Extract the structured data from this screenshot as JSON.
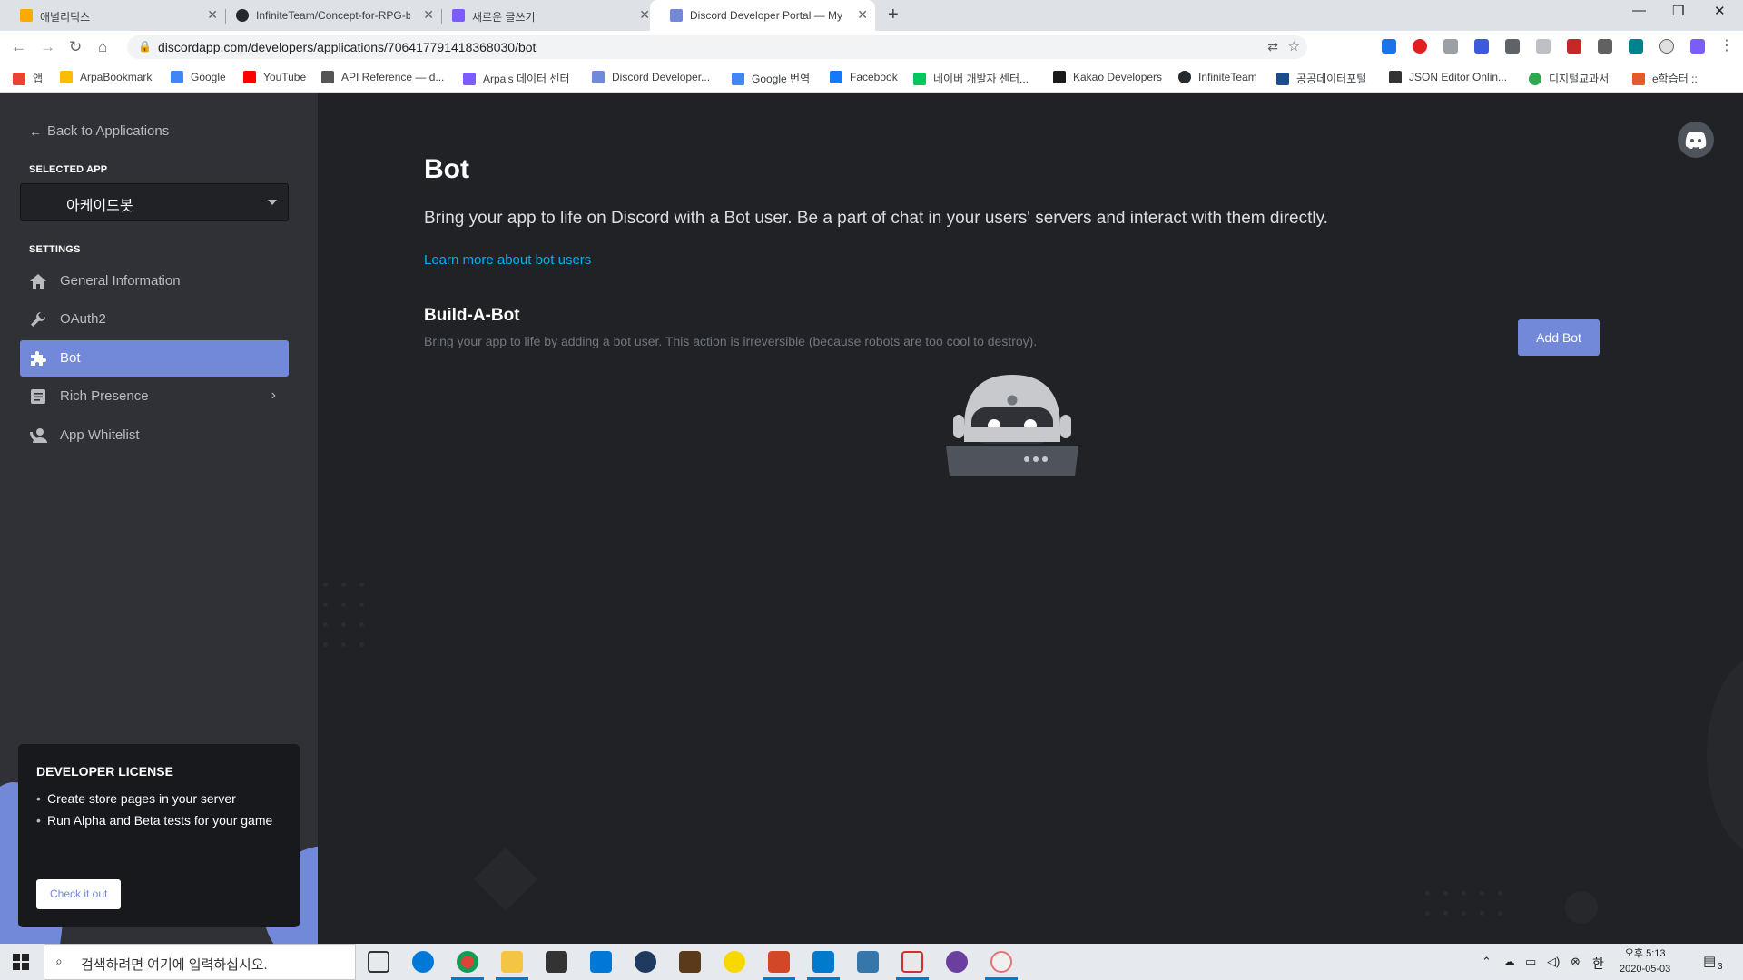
{
  "browser": {
    "tabs": [
      {
        "title": "애널리틱스",
        "color": "#f9ab00"
      },
      {
        "title": "InfiniteTeam/Concept-for-RPG-b",
        "color": "#24292e"
      },
      {
        "title": "새로운 글쓰기",
        "color": "#7c5cff"
      },
      {
        "title": "Discord Developer Portal — My",
        "color": "#7289da"
      }
    ],
    "url": "discordapp.com/developers/applications/706417791418368030/bot",
    "bookmarks": [
      {
        "label": "앱",
        "color": "#ea4335"
      },
      {
        "label": "ArpaBookmark",
        "color": "#fbbc04"
      },
      {
        "label": "Google",
        "color": "#4285f4"
      },
      {
        "label": "YouTube",
        "color": "#ff0000"
      },
      {
        "label": "API Reference — d...",
        "color": "#555555"
      },
      {
        "label": "Arpa's 데이터 센터",
        "color": "#7c5cff"
      },
      {
        "label": "Discord Developer...",
        "color": "#7289da"
      },
      {
        "label": "Google 번역",
        "color": "#4285f4"
      },
      {
        "label": "Facebook",
        "color": "#1877f2"
      },
      {
        "label": "네이버 개발자 센터...",
        "color": "#03c75a"
      },
      {
        "label": "Kakao Developers",
        "color": "#1a1a1a"
      },
      {
        "label": "InfiniteTeam",
        "color": "#24292e"
      },
      {
        "label": "공공데이터포털",
        "color": "#1c4c8c"
      },
      {
        "label": "JSON Editor Onlin...",
        "color": "#333333"
      },
      {
        "label": "디지털교과서",
        "color": "#2fa84f"
      },
      {
        "label": "e학습터 ::",
        "color": "#e45a2b"
      }
    ]
  },
  "sidebar": {
    "back_label": "Back to Applications",
    "selected_app_label": "SELECTED APP",
    "selected_app_name": "아케이드봇",
    "settings_label": "SETTINGS",
    "items": [
      {
        "label": "General Information",
        "icon": "home-icon"
      },
      {
        "label": "OAuth2",
        "icon": "wrench-icon"
      },
      {
        "label": "Bot",
        "icon": "puzzle-icon",
        "active": true
      },
      {
        "label": "Rich Presence",
        "icon": "document-icon",
        "has_chevron": true
      },
      {
        "label": "App Whitelist",
        "icon": "person-phone-icon"
      }
    ],
    "license": {
      "title": "DEVELOPER LICENSE",
      "bullets": [
        "Create store pages in your server",
        "Run Alpha and Beta tests for your game"
      ],
      "cta": "Check it out"
    }
  },
  "main": {
    "title": "Bot",
    "description": "Bring your app to life on Discord with a Bot user. Be a part of chat in your users' servers and interact with them directly.",
    "learn_more": "Learn more about bot users",
    "build_a_bot": {
      "title": "Build-A-Bot",
      "description": "Bring your app to life by adding a bot user. This action is irreversible (because robots are too cool to destroy).",
      "add_button": "Add Bot"
    }
  },
  "taskbar": {
    "search_placeholder": "검색하려면 여기에 입력하십시오.",
    "ime": "한",
    "time": "오후 5:13",
    "date": "2020-05-03",
    "notifications": "3"
  },
  "colors": {
    "accent": "#7289da",
    "sidebar_bg": "#2f3136",
    "main_bg": "#202225",
    "link": "#00b0f4"
  }
}
